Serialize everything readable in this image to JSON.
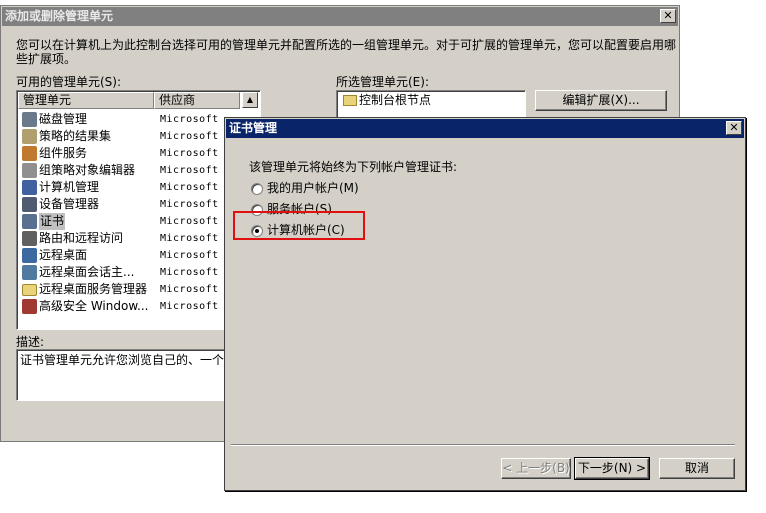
{
  "main_dialog": {
    "title": "添加或删除管理单元",
    "close": "✕",
    "description": "您可以在计算机上为此控制台选择可用的管理单元并配置所选的一组管理单元。对于可扩展的管理单元，您可以配置要启用哪些扩展项。",
    "available_label": "可用的管理单元(S):",
    "columns": {
      "name": "管理单元",
      "vendor": "供应商"
    },
    "snapins": [
      {
        "name": "磁盘管理",
        "vendor": "Microsoft ...",
        "icon": "disk-icon",
        "color": "#6a7a8a"
      },
      {
        "name": "策略的结果集",
        "vendor": "Microsoft ...",
        "icon": "policy-doc-icon",
        "color": "#b0a070"
      },
      {
        "name": "组件服务",
        "vendor": "Microsoft ...",
        "icon": "component-icon",
        "color": "#c07a30"
      },
      {
        "name": "组策略对象编辑器",
        "vendor": "Microsoft ...",
        "icon": "gpo-doc-icon",
        "color": "#909090"
      },
      {
        "name": "计算机管理",
        "vendor": "Microsoft ...",
        "icon": "computer-mgmt-icon",
        "color": "#4060a0"
      },
      {
        "name": "设备管理器",
        "vendor": "Microsoft ...",
        "icon": "device-mgr-icon",
        "color": "#505a70"
      },
      {
        "name": "证书",
        "vendor": "Microsoft ...",
        "icon": "certificate-icon",
        "color": "#5a7090"
      },
      {
        "name": "路由和远程访问",
        "vendor": "Microsoft ...",
        "icon": "routing-icon",
        "color": "#606060"
      },
      {
        "name": "远程桌面",
        "vendor": "Microsoft ...",
        "icon": "remote-desktop-icon",
        "color": "#3a6aa0"
      },
      {
        "name": "远程桌面会话主...",
        "vendor": "Microsoft ...",
        "icon": "rd-session-icon",
        "color": "#507aa0"
      },
      {
        "name": "远程桌面服务管理器",
        "vendor": "Microsoft ...",
        "icon": "folder-icon",
        "color": "#e8d27a"
      },
      {
        "name": "高级安全 Window...",
        "vendor": "Microsoft ...",
        "icon": "firewall-icon",
        "color": "#a03a30"
      }
    ],
    "selected_label": "所选管理单元(E):",
    "selected_item": "控制台根节点",
    "edit_button": "编辑扩展(X)...",
    "desc_label": "描述:",
    "desc_text": "证书管理单元允许您浏览自己的、一个服"
  },
  "cert_dialog": {
    "title": "证书管理",
    "close": "✕",
    "prompt": "该管理单元将始终为下列帐户管理证书:",
    "options": [
      {
        "label": "我的用户帐户(M)",
        "checked": false
      },
      {
        "label": "服务帐户(S)",
        "checked": false
      },
      {
        "label": "计算机帐户(C)",
        "checked": true
      }
    ],
    "back": "< 上一步(B)",
    "next": "下一步(N) >",
    "cancel": "取消",
    "highlight_color": "#e01010"
  }
}
